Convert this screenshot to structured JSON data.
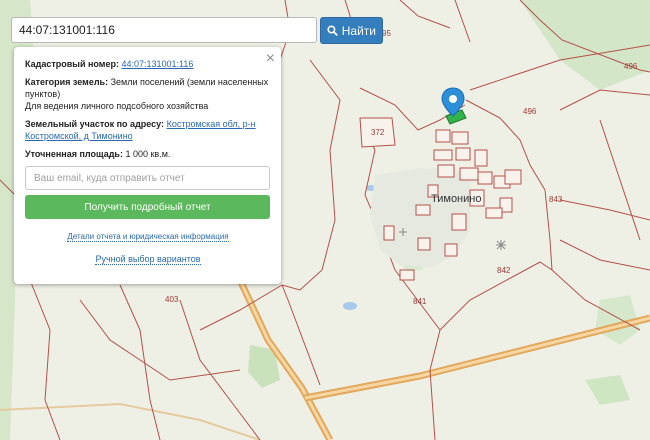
{
  "search": {
    "value": "44:07:131001:116",
    "button_label": "Найти",
    "button_icon": "search-icon"
  },
  "info_panel": {
    "cadastral_label": "Кадастровый номер:",
    "cadastral_value": "44:07:131001:116",
    "category_label": "Категория земель:",
    "category_value": "Земли поселений (земли населенных пунктов)",
    "usage_value": "Для ведения личного подсобного хозяйства",
    "address_label": "Земельный участок по адресу:",
    "address_value": "Костромская обл, р-н Костромской, д Тимонино",
    "area_label": "Уточненная площадь:",
    "area_value": "1 000 кв.м.",
    "email_placeholder": "Ваш email, куда отправить отчет",
    "report_button": "Получить подробный отчет",
    "details_link": "Детали отчета и юридическая информация",
    "manual_link": "Ручной выбор вариантов"
  },
  "map": {
    "village_name": "Тимонино",
    "plot_labels": [
      "95",
      "496",
      "496",
      "372",
      "843",
      "842",
      "841",
      "403"
    ],
    "colors": {
      "background": "#eef0e6",
      "boundary": "#b4504a",
      "road": "#e2a85c",
      "forest": "#cfe3c2",
      "marker": "#2d8fd8",
      "selected_plot": "#34b34a"
    }
  }
}
